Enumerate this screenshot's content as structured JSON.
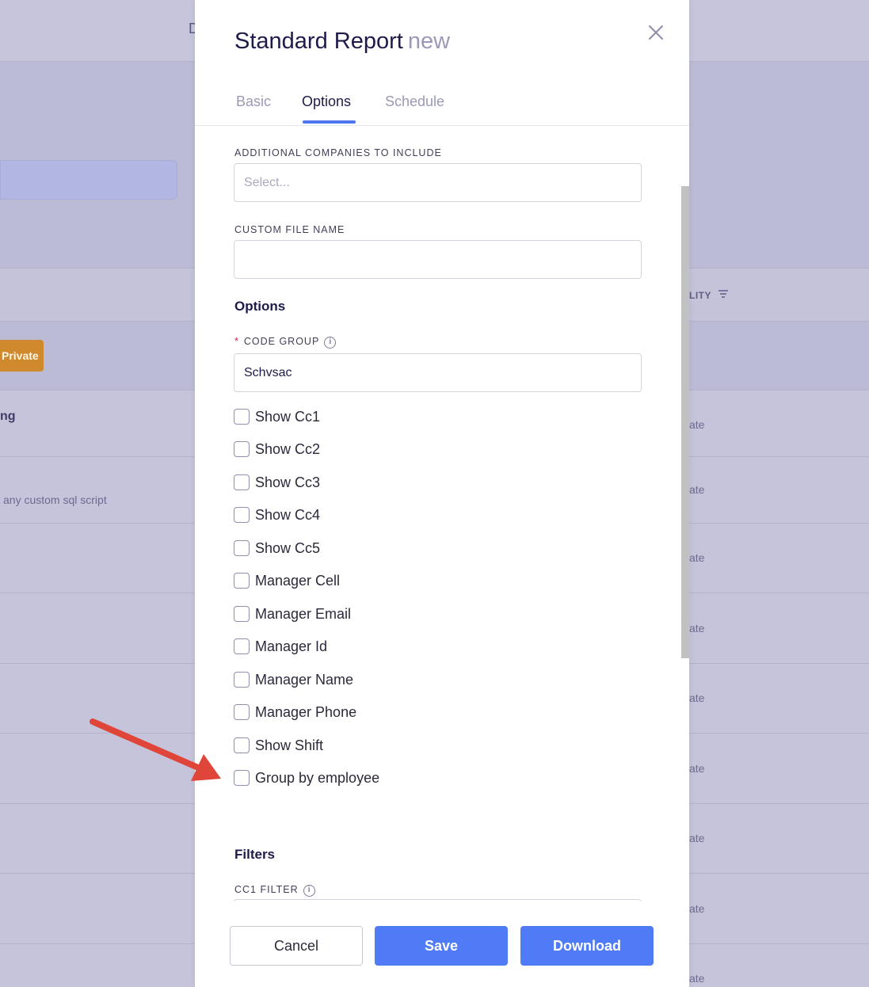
{
  "background": {
    "header_letter": "D",
    "column_label": "LITY",
    "filter_icon": "filter-icon",
    "private_badge": "Private",
    "row_title": "ng",
    "row_desc": "any custom sql script",
    "row_trailing": "ate"
  },
  "modal": {
    "title": "Standard Report",
    "title_sub": "new",
    "close_icon": "close-icon",
    "tabs": [
      {
        "label": "Basic"
      },
      {
        "label": "Options"
      },
      {
        "label": "Schedule"
      }
    ],
    "additional_companies": {
      "label": "ADDITIONAL COMPANIES TO INCLUDE",
      "placeholder": "Select..."
    },
    "custom_file_name": {
      "label": "CUSTOM FILE NAME",
      "value": ""
    },
    "options_title": "Options",
    "code_group": {
      "required_mark": "*",
      "label": "CODE GROUP",
      "value": "Schvsac",
      "info_icon": "info-icon"
    },
    "checkboxes": [
      {
        "label": "Show Cc1",
        "checked": false
      },
      {
        "label": "Show Cc2",
        "checked": false
      },
      {
        "label": "Show Cc3",
        "checked": false
      },
      {
        "label": "Show Cc4",
        "checked": false
      },
      {
        "label": "Show Cc5",
        "checked": false
      },
      {
        "label": "Manager Cell",
        "checked": false
      },
      {
        "label": "Manager Email",
        "checked": false
      },
      {
        "label": "Manager Id",
        "checked": false
      },
      {
        "label": "Manager Name",
        "checked": false
      },
      {
        "label": "Manager Phone",
        "checked": false
      },
      {
        "label": "Show Shift",
        "checked": false
      },
      {
        "label": "Group by employee",
        "checked": false
      }
    ],
    "filters_title": "Filters",
    "cc1_filter": {
      "label": "CC1 FILTER"
    },
    "footer": {
      "cancel": "Cancel",
      "save": "Save",
      "download": "Download"
    }
  },
  "colors": {
    "accent": "#4f7bf6",
    "private_badge": "#d08a2d",
    "annotation_arrow": "#e0453a"
  }
}
